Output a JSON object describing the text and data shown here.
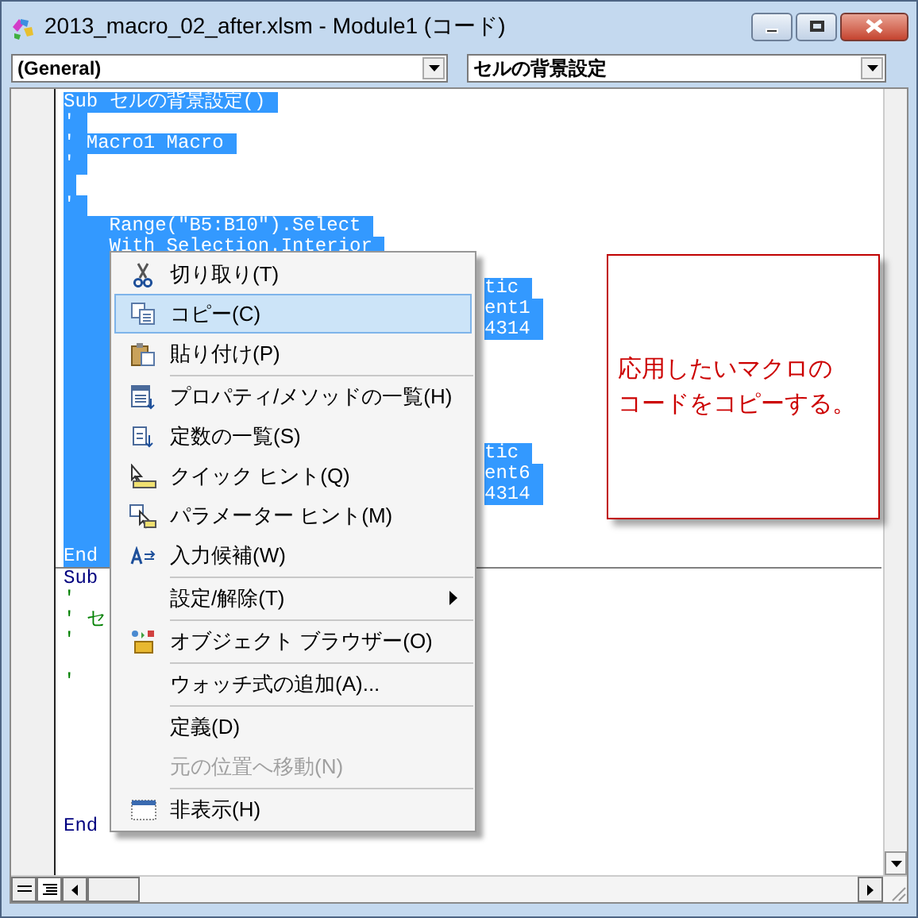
{
  "window": {
    "title": "2013_macro_02_after.xlsm - Module1 (コード)"
  },
  "object_dropdown": {
    "value": "(General)"
  },
  "procedure_dropdown": {
    "value": "セルの背景設定"
  },
  "code": {
    "procedures": [
      {
        "lines": [
          {
            "selected": true,
            "kind": "code",
            "text": "Sub セルの背景設定()"
          },
          {
            "selected": true,
            "kind": "code",
            "text": "'"
          },
          {
            "selected": true,
            "kind": "code",
            "text": "' Macro1 Macro"
          },
          {
            "selected": true,
            "kind": "code",
            "text": "'"
          },
          {
            "selected": true,
            "kind": "empty"
          },
          {
            "selected": true,
            "kind": "code",
            "text": "'"
          },
          {
            "selected": true,
            "kind": "code",
            "text": "    Range(\"B5:B10\").Select"
          },
          {
            "selected": true,
            "kind": "code",
            "text": "    With Selection.Interior"
          },
          {
            "selected": true,
            "kind": "covered"
          },
          {
            "selected": true,
            "kind": "covered",
            "tail": "tic"
          },
          {
            "selected": true,
            "kind": "covered",
            "tail": "ent1"
          },
          {
            "selected": true,
            "kind": "covered",
            "tail": "4314"
          },
          {
            "selected": true,
            "kind": "covered"
          },
          {
            "selected": true,
            "kind": "covered"
          },
          {
            "selected": true,
            "kind": "covered"
          },
          {
            "selected": true,
            "kind": "covered"
          },
          {
            "selected": true,
            "kind": "covered"
          },
          {
            "selected": true,
            "kind": "covered",
            "tail": "tic"
          },
          {
            "selected": true,
            "kind": "covered",
            "tail": "ent6"
          },
          {
            "selected": true,
            "kind": "covered",
            "tail": "4314"
          },
          {
            "selected": true,
            "kind": "covered"
          },
          {
            "selected": true,
            "kind": "covered"
          },
          {
            "selected": true,
            "kind": "keyword",
            "text": "End"
          }
        ]
      },
      {
        "lines": [
          {
            "selected": false,
            "kind": "keyword",
            "text": "Sub"
          },
          {
            "selected": false,
            "kind": "comment",
            "text": "'"
          },
          {
            "selected": false,
            "kind": "comment",
            "text": "' セ"
          },
          {
            "selected": false,
            "kind": "comment",
            "text": "'"
          },
          {
            "selected": false,
            "kind": "empty"
          },
          {
            "selected": false,
            "kind": "comment",
            "text": "'"
          },
          {
            "selected": false,
            "kind": "empty"
          },
          {
            "selected": false,
            "kind": "empty"
          },
          {
            "selected": false,
            "kind": "empty"
          },
          {
            "selected": false,
            "kind": "empty"
          },
          {
            "selected": false,
            "kind": "empty"
          },
          {
            "selected": false,
            "kind": "empty"
          },
          {
            "selected": false,
            "kind": "keyword",
            "text": "End"
          }
        ]
      }
    ]
  },
  "context_menu": {
    "items": [
      {
        "kind": "cut",
        "label": "切り取り(T)",
        "selected": false,
        "disabled": false
      },
      {
        "kind": "copy",
        "label": "コピー(C)",
        "selected": true,
        "disabled": false
      },
      {
        "kind": "paste",
        "label": "貼り付け(P)",
        "selected": false,
        "disabled": false
      },
      {
        "kind": "separator"
      },
      {
        "kind": "members",
        "label": "プロパティ/メソッドの一覧(H)",
        "selected": false,
        "disabled": false
      },
      {
        "kind": "constants",
        "label": "定数の一覧(S)",
        "selected": false,
        "disabled": false
      },
      {
        "kind": "quickinfo",
        "label": "クイック ヒント(Q)",
        "selected": false,
        "disabled": false
      },
      {
        "kind": "paraminfo",
        "label": "パラメーター ヒント(M)",
        "selected": false,
        "disabled": false
      },
      {
        "kind": "complete",
        "label": "入力候補(W)",
        "selected": false,
        "disabled": false
      },
      {
        "kind": "separator"
      },
      {
        "kind": "submenu",
        "label": "設定/解除(T)",
        "selected": false,
        "disabled": false
      },
      {
        "kind": "separator"
      },
      {
        "kind": "browser",
        "label": "オブジェクト ブラウザー(O)",
        "selected": false,
        "disabled": false
      },
      {
        "kind": "separator"
      },
      {
        "kind": "plain",
        "label": "ウォッチ式の追加(A)...",
        "selected": false,
        "disabled": false
      },
      {
        "kind": "separator"
      },
      {
        "kind": "plain",
        "label": "定義(D)",
        "selected": false,
        "disabled": false
      },
      {
        "kind": "plain",
        "label": "元の位置へ移動(N)",
        "selected": false,
        "disabled": true
      },
      {
        "kind": "separator"
      },
      {
        "kind": "hide",
        "label": "非表示(H)",
        "selected": false,
        "disabled": false
      }
    ]
  },
  "callout": {
    "lines": [
      "応用したいマクロの",
      "コードをコピーする。"
    ]
  }
}
